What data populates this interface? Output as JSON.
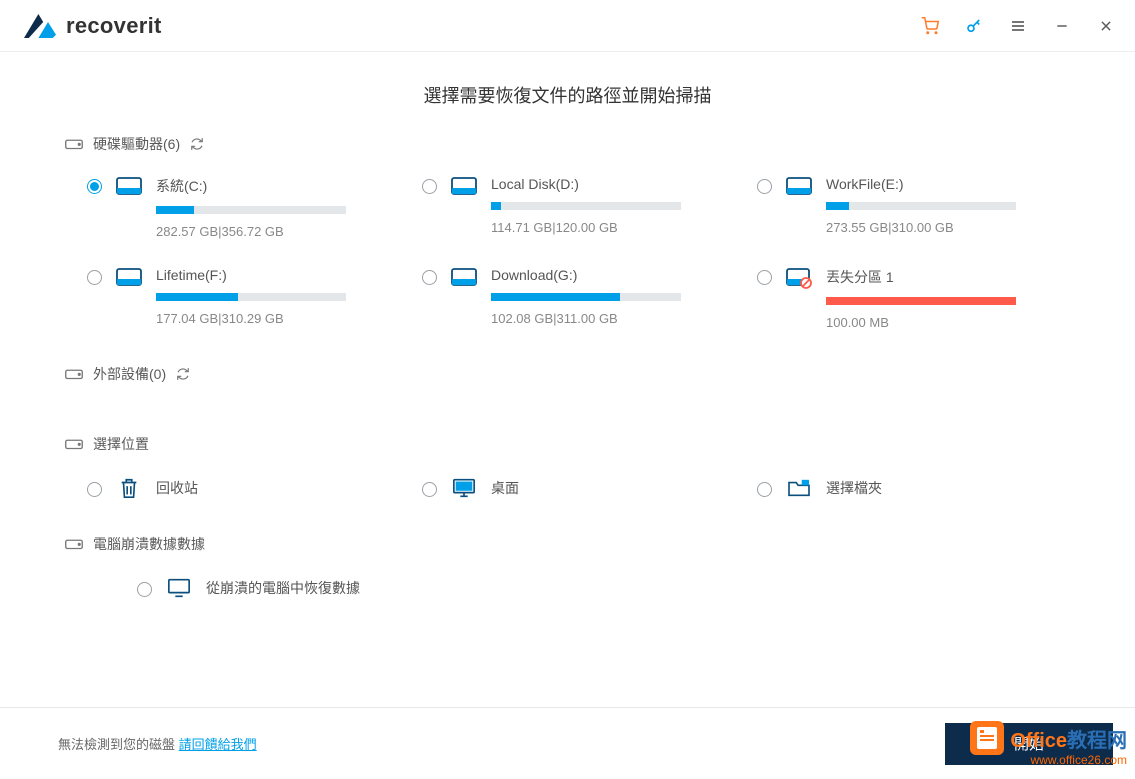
{
  "header": {
    "brand": "recoverit"
  },
  "page_title": "選擇需要恢復文件的路徑並開始掃描",
  "sections": {
    "hard_drives_label": "硬碟驅動器(6)",
    "external_label": "外部設備(0)",
    "locations_label": "選擇位置",
    "crash_label": "電腦崩潰數據數據"
  },
  "drives": [
    {
      "name": "系統(C:)",
      "size": "282.57  GB|356.72  GB",
      "fill": 20,
      "selected": true,
      "lost": false
    },
    {
      "name": "Local Disk(D:)",
      "size": "114.71  GB|120.00  GB",
      "fill": 5,
      "selected": false,
      "lost": false
    },
    {
      "name": "WorkFile(E:)",
      "size": "273.55  GB|310.00  GB",
      "fill": 12,
      "selected": false,
      "lost": false
    },
    {
      "name": "Lifetime(F:)",
      "size": "177.04  GB|310.29  GB",
      "fill": 43,
      "selected": false,
      "lost": false
    },
    {
      "name": "Download(G:)",
      "size": "102.08  GB|311.00  GB",
      "fill": 68,
      "selected": false,
      "lost": false
    },
    {
      "name": "丟失分區 1",
      "size": "100.00  MB",
      "fill": 100,
      "selected": false,
      "lost": true
    }
  ],
  "locations": [
    {
      "name": "回收站"
    },
    {
      "name": "桌面"
    },
    {
      "name": "選擇檔夾"
    }
  ],
  "crash_recovery": {
    "label": "從崩潰的電腦中恢復數據"
  },
  "footer": {
    "text": "無法檢測到您的磁盤",
    "link": "請回饋給我們",
    "start_button": "開始"
  },
  "watermark": {
    "text1": "Office",
    "text2": "教程网",
    "url": "www.office26.com"
  }
}
